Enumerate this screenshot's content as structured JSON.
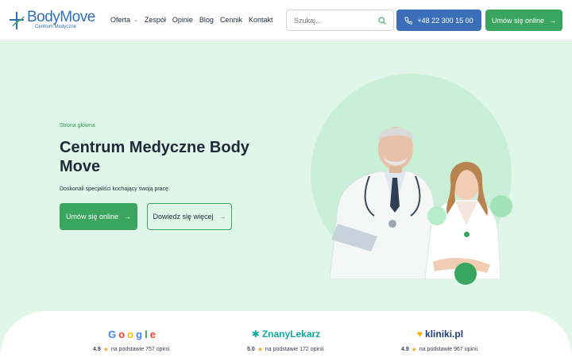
{
  "brand": {
    "name": "BodyMove",
    "subtitle": "Centrum Medyczne",
    "color": "#2f6fb3"
  },
  "nav": {
    "items": [
      {
        "label": "Oferta",
        "has_dropdown": true
      },
      {
        "label": "Zespół"
      },
      {
        "label": "Opinie"
      },
      {
        "label": "Blog"
      },
      {
        "label": "Cennik"
      },
      {
        "label": "Kontakt"
      }
    ]
  },
  "search": {
    "placeholder": "Szukaj..."
  },
  "header_buttons": {
    "phone": "+48 22 300 15 00",
    "book": "Umów się online"
  },
  "hero": {
    "breadcrumb": "Strona główna",
    "title": "Centrum Medyczne Body Move",
    "tagline": "Doskonali specjaliści kochający swoją pracę.",
    "primary_button": "Umów się online",
    "secondary_button": "Dowiedz się więcej"
  },
  "reviews": [
    {
      "provider": "Google",
      "score": "4.9",
      "text": "na podstawie 757 opinii."
    },
    {
      "provider": "ZnanyLekarz",
      "score": "5.0",
      "text": "na podstawie 172 opinii."
    },
    {
      "provider": "kliniki.pl",
      "score": "4.9",
      "text": "na podstawie 967 opinii."
    }
  ],
  "colors": {
    "accent_green": "#3aa55f",
    "accent_blue": "#3a6fb8",
    "hero_bg": "#dff6e8"
  },
  "icons": [
    "logo-cross-icon",
    "chevron-down-icon",
    "search-icon",
    "phone-icon",
    "arrow-right-icon",
    "star-icon"
  ]
}
